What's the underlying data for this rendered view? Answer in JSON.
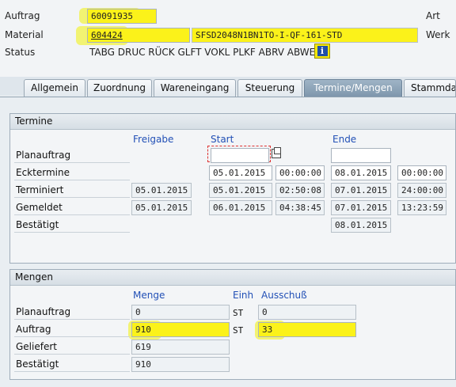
{
  "header": {
    "auftrag_label": "Auftrag",
    "auftrag_value": "60091935",
    "art_label": "Art",
    "material_label": "Material",
    "material_value": "604424",
    "material_desc": "SFSD2048N1BN1TO-I-QF-161-STD",
    "werk_label": "Werk",
    "status_label": "Status",
    "status_value": "TABG DRUC RÜCK GLFT VOKL PLKF ABRV ABWE*",
    "info_icon": "i"
  },
  "tabs": [
    {
      "label": "Allgemein"
    },
    {
      "label": "Zuordnung"
    },
    {
      "label": "Wareneingang"
    },
    {
      "label": "Steuerung"
    },
    {
      "label": "Termine/Mengen",
      "active": true
    },
    {
      "label": "Stammdat"
    }
  ],
  "termine": {
    "title": "Termine",
    "col_freigabe": "Freigabe",
    "col_start": "Start",
    "col_ende": "Ende",
    "rows": {
      "planauftrag": {
        "label": "Planauftrag",
        "start_date": "",
        "end_date": ""
      },
      "ecktermine": {
        "label": "Ecktermine",
        "start_date": "05.01.2015",
        "start_time": "00:00:00",
        "end_date": "08.01.2015",
        "end_time": "00:00:00"
      },
      "terminiert": {
        "label": "Terminiert",
        "freigabe": "05.01.2015",
        "start_date": "05.01.2015",
        "start_time": "02:50:08",
        "end_date": "07.01.2015",
        "end_time": "24:00:00"
      },
      "gemeldet": {
        "label": "Gemeldet",
        "freigabe": "05.01.2015",
        "start_date": "06.01.2015",
        "start_time": "04:38:45",
        "end_date": "07.01.2015",
        "end_time": "13:23:59"
      },
      "bestaetigt": {
        "label": "Bestätigt",
        "end_date": "08.01.2015"
      }
    }
  },
  "mengen": {
    "title": "Mengen",
    "col_menge": "Menge",
    "col_einh": "Einh",
    "col_ausschuss": "Ausschuß",
    "rows": {
      "planauftrag": {
        "label": "Planauftrag",
        "menge": "0",
        "einh": "ST",
        "ausschuss": "0"
      },
      "auftrag": {
        "label": "Auftrag",
        "menge": "910",
        "einh": "ST",
        "ausschuss": "33"
      },
      "geliefert": {
        "label": "Geliefert",
        "menge": "619"
      },
      "bestaetigt": {
        "label": "Bestätigt",
        "menge": "910"
      }
    }
  },
  "colors": {
    "highlight": "#fbf21a",
    "header_blue": "#2250b6",
    "active_tab": "#7d95ab"
  }
}
